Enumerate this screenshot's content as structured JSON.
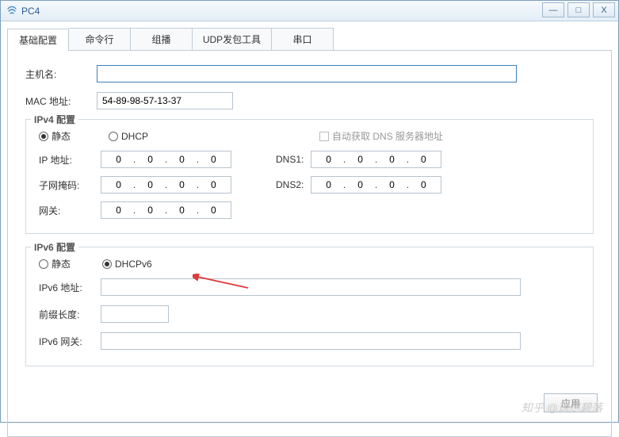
{
  "window": {
    "title": "PC4"
  },
  "tabs": [
    "基础配置",
    "命令行",
    "组播",
    "UDP发包工具",
    "串口"
  ],
  "labels": {
    "host": "主机名:",
    "mac": "MAC 地址:",
    "ipv4_legend": "IPv4 配置",
    "ipv6_legend": "IPv6 配置",
    "static": "静态",
    "dhcp": "DHCP",
    "dhcpv6": "DHCPv6",
    "autodns": "自动获取 DNS 服务器地址",
    "ip": "IP 地址:",
    "mask": "子网掩码:",
    "gw": "网关:",
    "dns1": "DNS1:",
    "dns2": "DNS2:",
    "ipv6_addr": "IPv6 地址:",
    "prefix": "前缀长度:",
    "ipv6_gw": "IPv6 网关:",
    "apply": "应用"
  },
  "values": {
    "mac": "54-89-98-57-13-37",
    "oct": "0"
  },
  "watermark": "知乎 @琼尽碧落"
}
